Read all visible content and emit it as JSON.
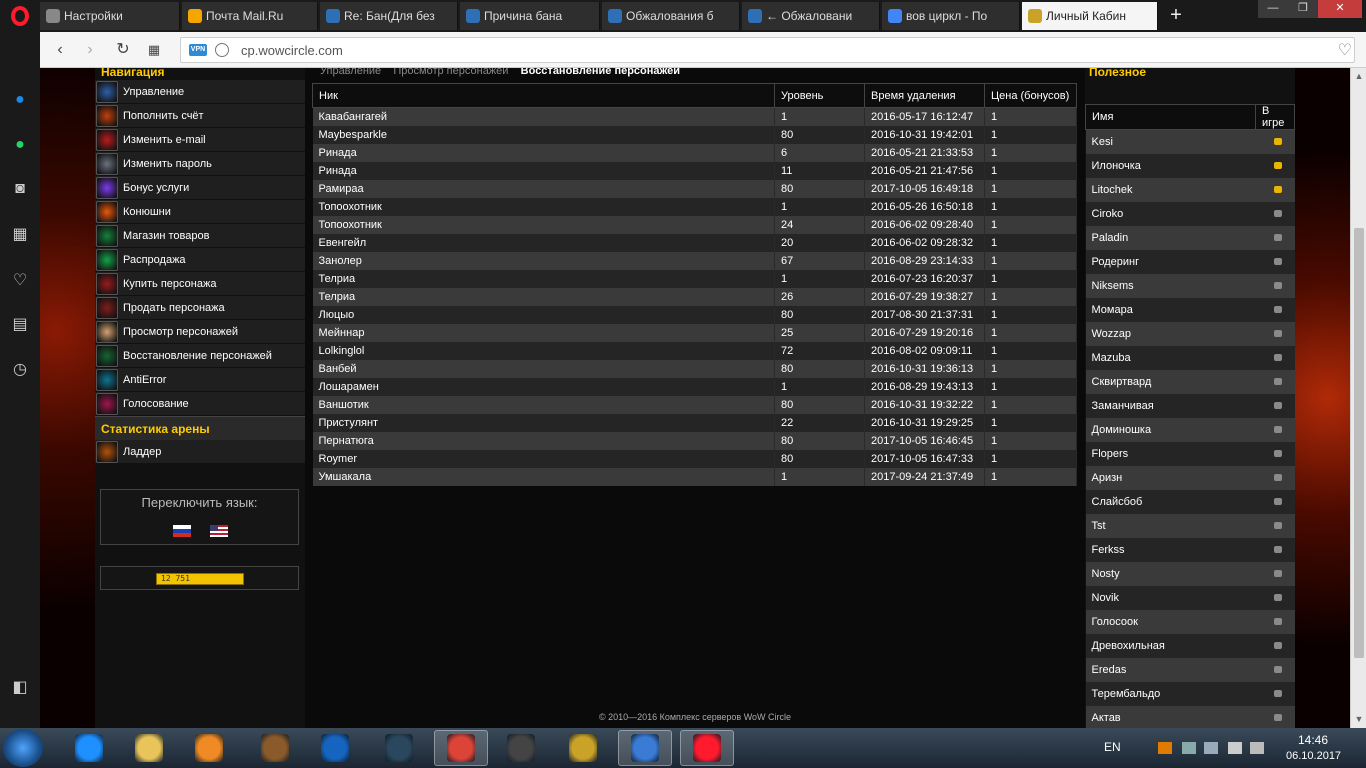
{
  "browser": {
    "tabs": [
      {
        "title": "Настройки",
        "favicon": "gear-icon",
        "color": "#888888"
      },
      {
        "title": "Почта Mail.Ru",
        "favicon": "mail-at-icon",
        "color": "#f7a600"
      },
      {
        "title": "Re: Бан(Для без",
        "favicon": "mail-reply-icon",
        "color": "#2f6fb5"
      },
      {
        "title": "Причина бана",
        "favicon": "mail-reply-icon",
        "color": "#2f6fb5"
      },
      {
        "title": "Обжалования б",
        "favicon": "mail-reply-icon",
        "color": "#2f6fb5"
      },
      {
        "title": "← Обжаловани",
        "favicon": "mail-reply-icon",
        "color": "#2f6fb5"
      },
      {
        "title": "вов циркл - По",
        "favicon": "google-g-icon",
        "color": "#4285f4"
      },
      {
        "title": "Личный Кабин",
        "favicon": "wow-w-icon",
        "color": "#c9a227"
      }
    ],
    "url": "cp.wowcircle.com",
    "vpn_label": "VPN"
  },
  "site": {
    "nav_heading": "Навигация",
    "nav_items": [
      {
        "label": "Управление",
        "icon": "control-icon",
        "color": "#2f5fa8"
      },
      {
        "label": "Пополнить счёт",
        "icon": "fire-icon",
        "color": "#c2410c"
      },
      {
        "label": "Изменить e-mail",
        "icon": "flame-icon",
        "color": "#b91c1c"
      },
      {
        "label": "Изменить пароль",
        "icon": "mask-icon",
        "color": "#6b7280"
      },
      {
        "label": "Бонус услуги",
        "icon": "sparkle-icon",
        "color": "#7c3aed"
      },
      {
        "label": "Конюшни",
        "icon": "blaze-icon",
        "color": "#ea580c"
      },
      {
        "label": "Магазин товаров",
        "icon": "orb-icon",
        "color": "#15803d"
      },
      {
        "label": "Распродажа",
        "icon": "leaf-icon",
        "color": "#16a34a"
      },
      {
        "label": "Купить персонажа",
        "icon": "demon-icon",
        "color": "#991b1b"
      },
      {
        "label": "Продать персонажа",
        "icon": "demon-icon",
        "color": "#7f1d1d"
      },
      {
        "label": "Просмотр персонажей",
        "icon": "face-icon",
        "color": "#d4a373"
      },
      {
        "label": "Восстановление персонажей",
        "icon": "nature-icon",
        "color": "#166534"
      },
      {
        "label": "AntiError",
        "icon": "swirl-icon",
        "color": "#0e7490"
      },
      {
        "label": "Голосование",
        "icon": "cross-icon",
        "color": "#9d174d"
      }
    ],
    "arena_heading": "Статистика арены",
    "arena_items": [
      {
        "label": "Ладдер",
        "icon": "trophy-icon",
        "color": "#b45309"
      }
    ],
    "lang_title": "Переключить язык:",
    "counter_value": "12 751",
    "page_tabs": [
      "Управление",
      "Просмотр персонажей",
      "Восстановление персонажей"
    ],
    "table_headers": [
      "Ник",
      "Уровень",
      "Время удаления",
      "Цена (бонусов)"
    ],
    "deleted_characters": [
      {
        "nick": "Кавабангагей",
        "level": "1",
        "deleted": "2016-05-17 16:12:47",
        "price": "1"
      },
      {
        "nick": "Maybesparkle",
        "level": "80",
        "deleted": "2016-10-31 19:42:01",
        "price": "1"
      },
      {
        "nick": "Ринада",
        "level": "6",
        "deleted": "2016-05-21 21:33:53",
        "price": "1"
      },
      {
        "nick": "Ринада",
        "level": "11",
        "deleted": "2016-05-21 21:47:56",
        "price": "1"
      },
      {
        "nick": "Рамираа",
        "level": "80",
        "deleted": "2017-10-05 16:49:18",
        "price": "1"
      },
      {
        "nick": "Топоохотник",
        "level": "1",
        "deleted": "2016-05-26 16:50:18",
        "price": "1"
      },
      {
        "nick": "Топоохотник",
        "level": "24",
        "deleted": "2016-06-02 09:28:40",
        "price": "1"
      },
      {
        "nick": "Евенгейл",
        "level": "20",
        "deleted": "2016-06-02 09:28:32",
        "price": "1"
      },
      {
        "nick": "Занолер",
        "level": "67",
        "deleted": "2016-08-29 23:14:33",
        "price": "1"
      },
      {
        "nick": "Телриа",
        "level": "1",
        "deleted": "2016-07-23 16:20:37",
        "price": "1"
      },
      {
        "nick": "Телриа",
        "level": "26",
        "deleted": "2016-07-29 19:38:27",
        "price": "1"
      },
      {
        "nick": "Люцыо",
        "level": "80",
        "deleted": "2017-08-30 21:37:31",
        "price": "1"
      },
      {
        "nick": "Мейннар",
        "level": "25",
        "deleted": "2016-07-29 19:20:16",
        "price": "1"
      },
      {
        "nick": "Lolkinglol",
        "level": "72",
        "deleted": "2016-08-02 09:09:11",
        "price": "1"
      },
      {
        "nick": "Ванбей",
        "level": "80",
        "deleted": "2016-10-31 19:36:13",
        "price": "1"
      },
      {
        "nick": "Лошарамен",
        "level": "1",
        "deleted": "2016-08-29 19:43:13",
        "price": "1"
      },
      {
        "nick": "Ваншотик",
        "level": "80",
        "deleted": "2016-10-31 19:32:22",
        "price": "1"
      },
      {
        "nick": "Пристулянт",
        "level": "22",
        "deleted": "2016-10-31 19:29:25",
        "price": "1"
      },
      {
        "nick": "Пернатюга",
        "level": "80",
        "deleted": "2017-10-05 16:46:45",
        "price": "1"
      },
      {
        "nick": "Roymer",
        "level": "80",
        "deleted": "2017-10-05 16:47:33",
        "price": "1"
      },
      {
        "nick": "Умшакала",
        "level": "1",
        "deleted": "2017-09-24 21:37:49",
        "price": "1"
      }
    ],
    "useful_heading": "Полезное",
    "players_headers": [
      "Имя",
      "В игре"
    ],
    "players": [
      {
        "name": "Kesi",
        "online": true
      },
      {
        "name": "Илоночка",
        "online": true
      },
      {
        "name": "Litochek",
        "online": true
      },
      {
        "name": "Ciroko",
        "online": false
      },
      {
        "name": "Paladin",
        "online": false
      },
      {
        "name": "Родеринг",
        "online": false
      },
      {
        "name": "Niksems",
        "online": false
      },
      {
        "name": "Момара",
        "online": false
      },
      {
        "name": "Wozzap",
        "online": false
      },
      {
        "name": "Mazuba",
        "online": false
      },
      {
        "name": "Сквиртвард",
        "online": false
      },
      {
        "name": "Заманчивая",
        "online": false
      },
      {
        "name": "Доминошка",
        "online": false
      },
      {
        "name": "Flopers",
        "online": false
      },
      {
        "name": "Аризн",
        "online": false
      },
      {
        "name": "Слайсбоб",
        "online": false
      },
      {
        "name": "Tst",
        "online": false
      },
      {
        "name": "Ferkss",
        "online": false
      },
      {
        "name": "Nosty",
        "online": false
      },
      {
        "name": "Novik",
        "online": false
      },
      {
        "name": "Голосоок",
        "online": false
      },
      {
        "name": "Древохильная",
        "online": false
      },
      {
        "name": "Eredas",
        "online": false
      },
      {
        "name": "Терембальдо",
        "online": false
      },
      {
        "name": "Актав",
        "online": false
      }
    ],
    "footer": "© 2010—2016 Комплекс серверов WoW Circle"
  },
  "taskbar": {
    "apps": [
      {
        "name": "internet-explorer-icon",
        "color": "#1e90ff",
        "active": false
      },
      {
        "name": "file-explorer-icon",
        "color": "#e8c45a",
        "active": false
      },
      {
        "name": "media-player-icon",
        "color": "#f08a24",
        "active": false
      },
      {
        "name": "hearthstone-icon",
        "color": "#8b5a2b",
        "active": false
      },
      {
        "name": "blizzard-icon",
        "color": "#1565c0",
        "active": false
      },
      {
        "name": "steam-icon",
        "color": "#2a475e",
        "active": false
      },
      {
        "name": "chrome-icon",
        "color": "#db4437",
        "active": true
      },
      {
        "name": "nox-icon",
        "color": "#444444",
        "active": false
      },
      {
        "name": "wow-icon",
        "color": "#c9a227",
        "active": false
      },
      {
        "name": "app-c-icon",
        "color": "#3a7bd5",
        "active": true
      },
      {
        "name": "opera-icon",
        "color": "#ff1b2d",
        "active": true
      }
    ],
    "language": "EN",
    "time": "14:46",
    "date": "06.10.2017"
  }
}
